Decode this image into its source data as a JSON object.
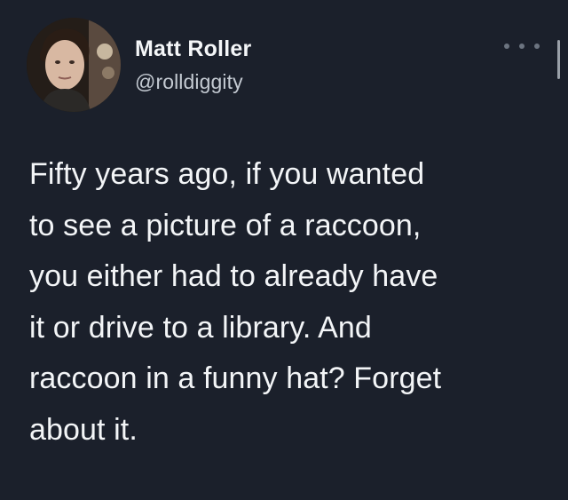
{
  "author": {
    "name": "Matt Roller",
    "handle": "@rolldiggity"
  },
  "icons": {
    "avatar": "profile-photo",
    "more": "ellipsis-horizontal-icon"
  },
  "tweet": {
    "text": "Fifty years ago, if you wanted\nto see a picture of a raccoon,\nyou either had to already have\nit or drive to a library. And\nraccoon in a funny hat? Forget\nabout it."
  },
  "colors": {
    "background": "#1b202b",
    "text": "#f3f5f7",
    "secondary_text": "#c4cad2"
  }
}
